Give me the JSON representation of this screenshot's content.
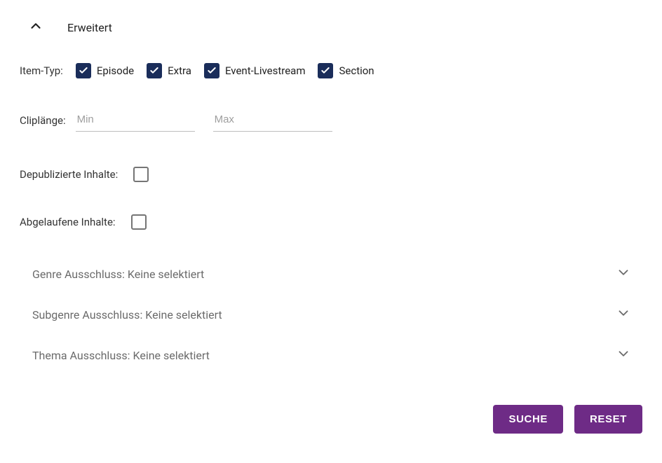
{
  "header": {
    "title": "Erweitert"
  },
  "itemType": {
    "label": "Item-Typ:",
    "options": [
      {
        "label": "Episode",
        "checked": true
      },
      {
        "label": "Extra",
        "checked": true
      },
      {
        "label": "Event-Livestream",
        "checked": true
      },
      {
        "label": "Section",
        "checked": true
      }
    ]
  },
  "clipLength": {
    "label": "Cliplänge:",
    "min_placeholder": "Min",
    "max_placeholder": "Max",
    "min_value": "",
    "max_value": ""
  },
  "depublished": {
    "label": "Depublizierte Inhalte:",
    "checked": false
  },
  "expired": {
    "label": "Abgelaufene Inhalte:",
    "checked": false
  },
  "panels": [
    {
      "title": "Genre Ausschluss: Keine selektiert"
    },
    {
      "title": "Subgenre Ausschluss: Keine selektiert"
    },
    {
      "title": "Thema Ausschluss: Keine selektiert"
    }
  ],
  "buttons": {
    "search": "Suche",
    "reset": "Reset"
  }
}
